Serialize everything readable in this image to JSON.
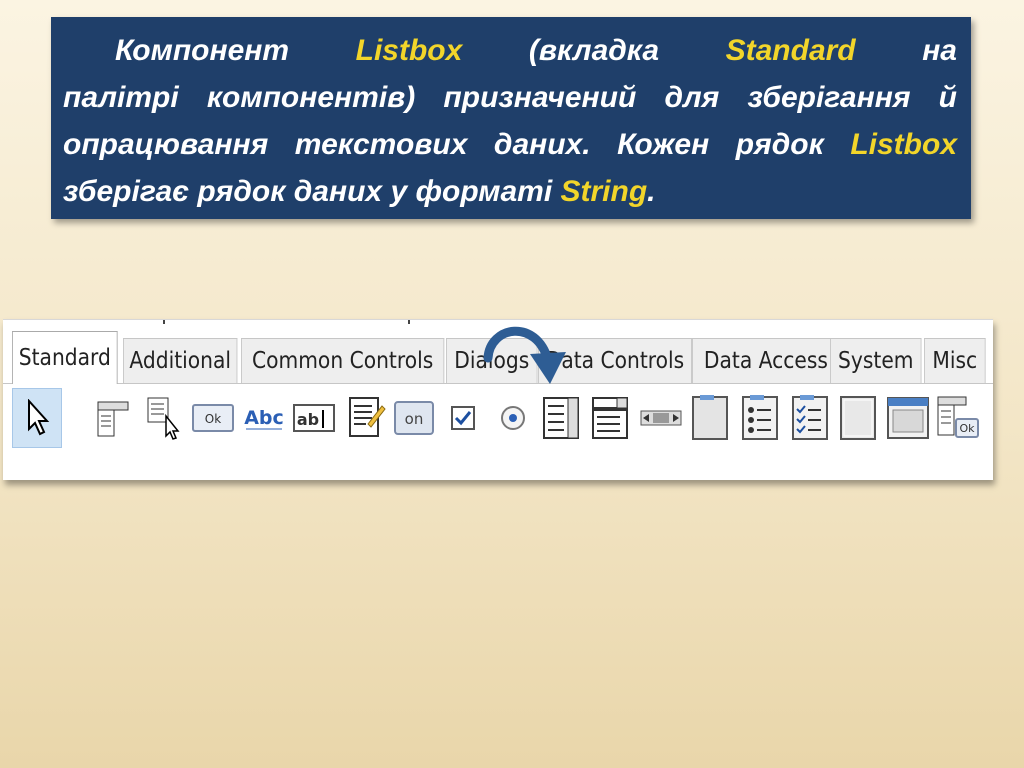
{
  "note": {
    "w1": "Компонент",
    "listbox": "Listbox",
    "w2": "(вкладка",
    "standard": "Standard",
    "w3": "на палітрі компонентів) призначений для зберігання й опрацювання текстових даних. Кожен рядок",
    "listbox2": "Listbox",
    "w4": "зберігає рядок даних у форматі",
    "string": "String",
    "end": "."
  },
  "palette": {
    "tabs": [
      "Standard",
      "Additional",
      "Common Controls",
      "Dialogs",
      "Data Controls",
      "Data Access",
      "System",
      "Misc"
    ],
    "active_tab": "Standard",
    "tools": [
      {
        "name": "pointer-tool-icon"
      },
      {
        "name": "frame-icon"
      },
      {
        "name": "popup-menu-icon"
      },
      {
        "name": "button-icon",
        "label": "Ok"
      },
      {
        "name": "label-icon",
        "label": "Abc"
      },
      {
        "name": "edit-icon",
        "label": "ab"
      },
      {
        "name": "memo-icon"
      },
      {
        "name": "toggle-box-icon",
        "label": "on"
      },
      {
        "name": "checkbox-icon"
      },
      {
        "name": "radio-button-icon"
      },
      {
        "name": "listbox-icon"
      },
      {
        "name": "combobox-icon"
      },
      {
        "name": "scrollbar-icon"
      },
      {
        "name": "groupbox-icon"
      },
      {
        "name": "radio-group-icon"
      },
      {
        "name": "check-group-icon"
      },
      {
        "name": "panel-icon"
      },
      {
        "name": "frame-window-icon"
      },
      {
        "name": "action-list-icon",
        "label": "Ok"
      }
    ]
  },
  "colors": {
    "note_bg": "#1f3f6a",
    "highlight": "#f2d52a",
    "arrow": "#2e5d94"
  }
}
